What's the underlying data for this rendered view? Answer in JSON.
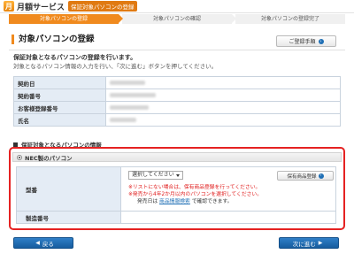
{
  "header": {
    "logo_glyph": "月",
    "title": "月額サービス",
    "subtitle": "保証対象パソコンの登録"
  },
  "steps": [
    {
      "label": "対象パソコンの登録",
      "active": true
    },
    {
      "label": "対象パソコンの確認",
      "active": false
    },
    {
      "label": "対象パソコンの登録完了",
      "active": false
    }
  ],
  "page": {
    "title": "対象パソコンの登録",
    "guide_button": "ご登録手順",
    "intro_bold": "保証対象となるパソコンの登録を行います。",
    "intro": "対象となるパソコン情報の入力を行い、「次に進む」ボタンを押してください。"
  },
  "contract_table": [
    {
      "label": "契約日"
    },
    {
      "label": "契約番号"
    },
    {
      "label": "お客様登録番号"
    },
    {
      "label": "氏名"
    }
  ],
  "pc_section": {
    "heading": "保証対象となるパソコンの情報",
    "nec_option": "NEC製のパソコン",
    "model_label": "型番",
    "model_select": "選択してください",
    "registered_button": "保有商品登録",
    "note1": "※リストにない場合は、保有商品登録を行ってください。",
    "note2": "※発売から4年2か月以内のパソコンを選択してください。",
    "note3_prefix": "発売日は",
    "note3_link": "商品情報検索",
    "note3_suffix": "で確認できます。",
    "serial_label": "製造番号"
  },
  "nav": {
    "back_label": "戻る",
    "next_label": "次に進む"
  },
  "colors": {
    "accent": "#f08a1e",
    "primary_button": "#1f6fb5",
    "highlight_frame": "#e52222",
    "table_label_bg": "#e4ecf5"
  }
}
